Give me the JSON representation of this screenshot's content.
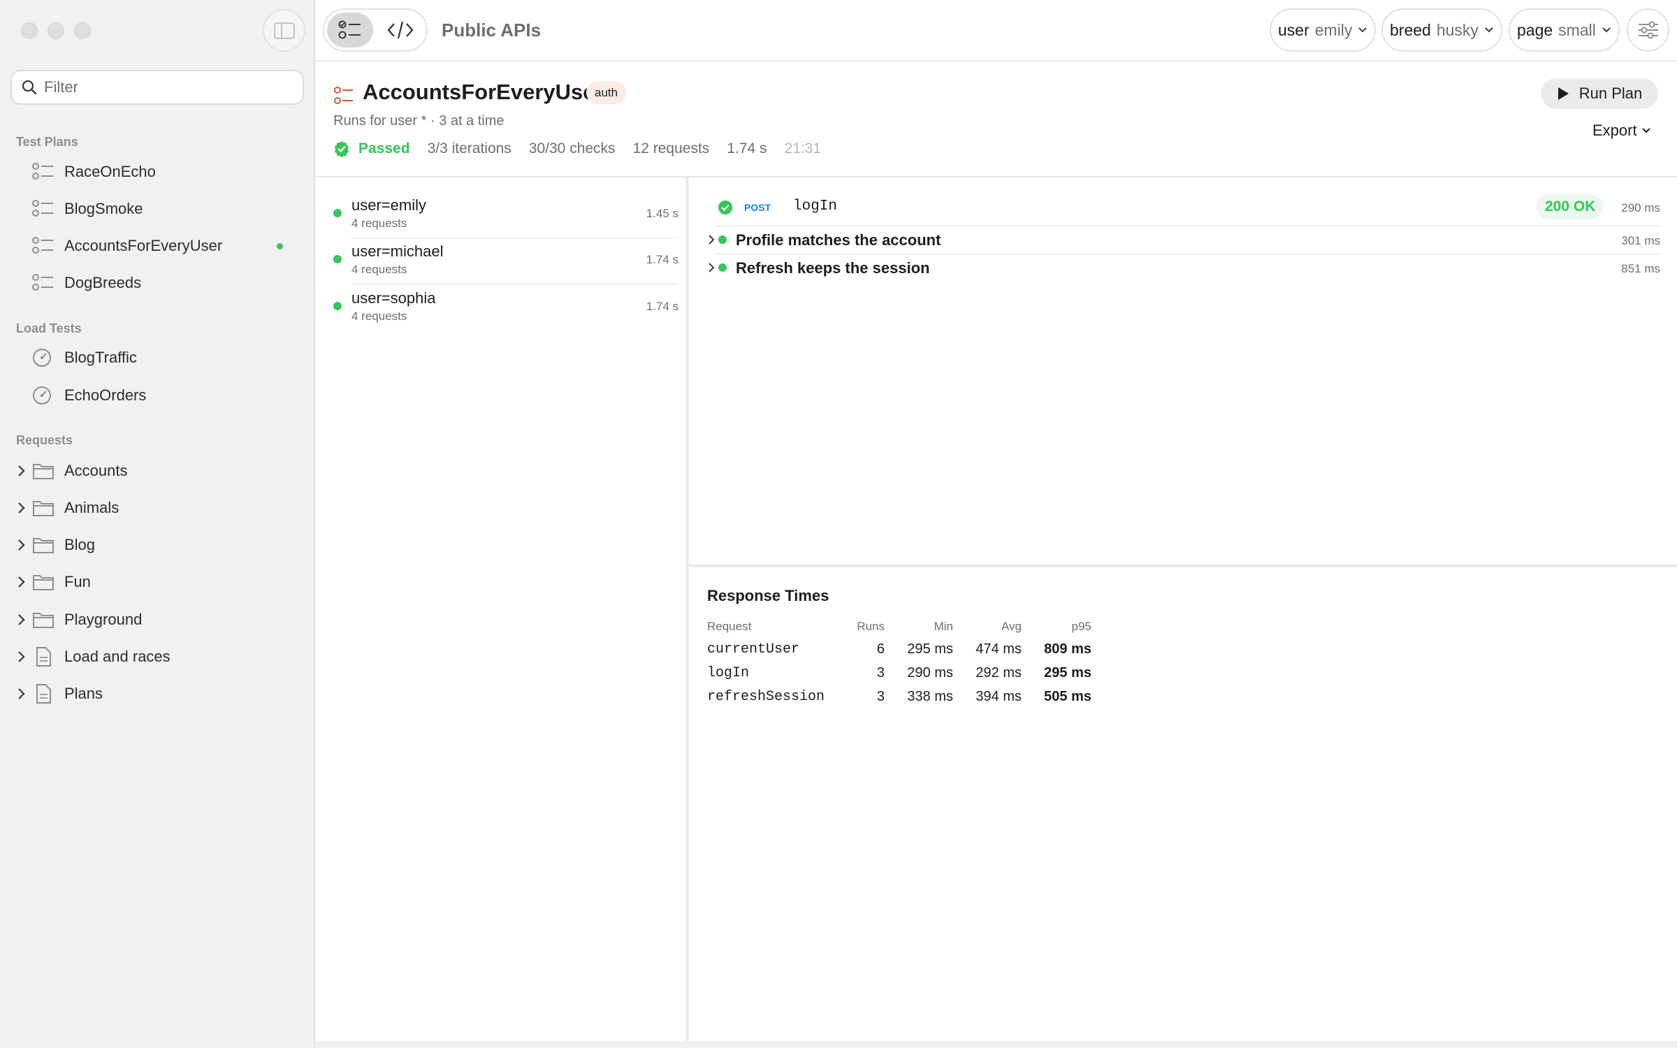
{
  "sidebar": {
    "filter_placeholder": "Filter",
    "sections": {
      "test_plans": "Test Plans",
      "load_tests": "Load Tests",
      "requests": "Requests"
    },
    "test_plans": [
      {
        "label": "RaceOnEcho"
      },
      {
        "label": "BlogSmoke"
      },
      {
        "label": "AccountsForEveryUser",
        "selected": true
      },
      {
        "label": "DogBreeds"
      }
    ],
    "load_tests": [
      {
        "label": "BlogTraffic"
      },
      {
        "label": "EchoOrders"
      }
    ],
    "requests": [
      {
        "label": "Accounts",
        "icon": "folder-icon"
      },
      {
        "label": "Animals",
        "icon": "folder-icon"
      },
      {
        "label": "Blog",
        "icon": "folder-icon"
      },
      {
        "label": "Fun",
        "icon": "folder-icon"
      },
      {
        "label": "Playground",
        "icon": "folder-icon"
      },
      {
        "label": "Load and races",
        "icon": "document-icon"
      },
      {
        "label": "Plans",
        "icon": "document-icon"
      }
    ]
  },
  "toolbar": {
    "title": "Public APIs",
    "pills": [
      {
        "key": "user",
        "value": "emily"
      },
      {
        "key": "breed",
        "value": "husky"
      },
      {
        "key": "page",
        "value": "small"
      }
    ]
  },
  "plan": {
    "title": "AccountsForEveryUser",
    "tag": "auth",
    "subtitle": "Runs for user * · 3 at a time",
    "status": "Passed",
    "iterations": "3/3 iterations",
    "checks": "30/30 checks",
    "requests": "12 requests",
    "duration": "1.74 s",
    "time": "21:31",
    "run_label": "Run Plan",
    "export_label": "Export"
  },
  "iterations": [
    {
      "name": "user=emily",
      "sub": "4 requests",
      "duration": "1.45 s"
    },
    {
      "name": "user=michael",
      "sub": "4 requests",
      "duration": "1.74 s"
    },
    {
      "name": "user=sophia",
      "sub": "4 requests",
      "duration": "1.74 s"
    }
  ],
  "steps": {
    "request": {
      "method": "POST",
      "name": "logIn",
      "status": "200 OK",
      "duration": "290 ms"
    },
    "groups": [
      {
        "title": "Profile matches the account",
        "duration": "301 ms"
      },
      {
        "title": "Refresh keeps the session",
        "duration": "851 ms"
      }
    ]
  },
  "response_times": {
    "title": "Response Times",
    "headers": [
      "Request",
      "Runs",
      "Min",
      "Avg",
      "p95"
    ],
    "rows": [
      [
        "currentUser",
        "6",
        "295 ms",
        "474 ms",
        "809 ms"
      ],
      [
        "logIn",
        "3",
        "290 ms",
        "292 ms",
        "295 ms"
      ],
      [
        "refreshSession",
        "3",
        "338 ms",
        "394 ms",
        "505 ms"
      ]
    ]
  },
  "colors": {
    "accent_green": "#34c759",
    "method_blue": "#0a84ff",
    "plan_icon_red": "#e0533a"
  }
}
